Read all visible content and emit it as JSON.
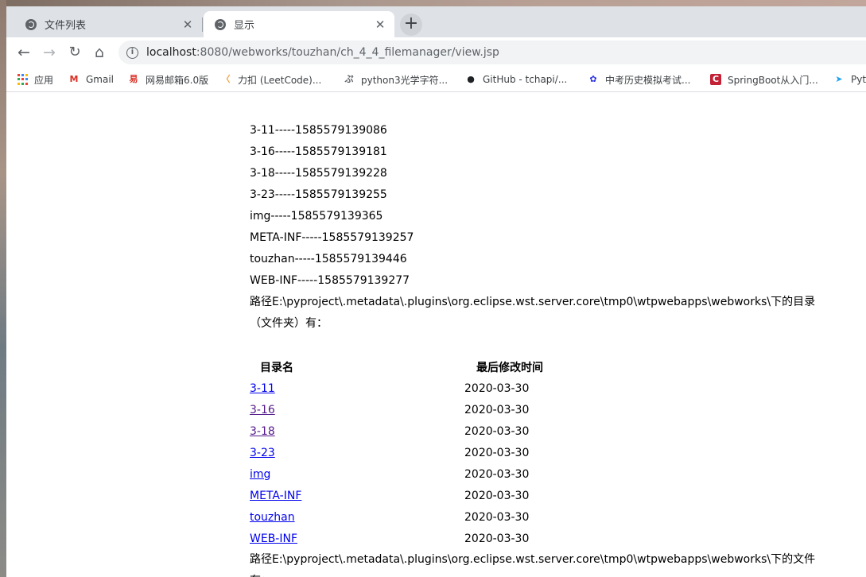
{
  "browser": {
    "tabs": [
      {
        "title": "文件列表",
        "close": "✕",
        "active": false
      },
      {
        "title": "显示",
        "close": "✕",
        "active": true
      }
    ],
    "new_tab": "+",
    "nav": {
      "back": "←",
      "forward": "→",
      "reload": "↻",
      "home": "⌂"
    },
    "url": {
      "host": "localhost",
      "rest": ":8080/webworks/touzhan/ch_4_4_filemanager/view.jsp"
    },
    "bookmarks": [
      {
        "label": "应用",
        "icon": "apps-grid-icon"
      },
      {
        "label": "Gmail",
        "icon": "gmail-icon",
        "color": "#d93025",
        "glyph": "M"
      },
      {
        "label": "网易邮箱6.0版",
        "icon": "netease-mail-icon",
        "color": "#d93025",
        "glyph": "易"
      },
      {
        "label": "力扣 (LeetCode)...",
        "icon": "leetcode-icon",
        "color": "#f0a03c",
        "glyph": "〈"
      },
      {
        "label": "python3光学字符...",
        "icon": "python-ocr-icon",
        "color": "#5f6368",
        "glyph": "ぷ"
      },
      {
        "label": "GitHub - tchapi/...",
        "icon": "github-icon",
        "color": "#202124",
        "glyph": "●"
      },
      {
        "label": "中考历史模拟考试...",
        "icon": "baidu-icon",
        "color": "#2932e1",
        "glyph": "✿"
      },
      {
        "label": "SpringBoot从入门...",
        "icon": "csdn-icon",
        "color": "#c32136",
        "glyph": "C"
      },
      {
        "label": "Pyt",
        "icon": "python-bird-icon",
        "color": "#1da1f2",
        "glyph": "➤"
      }
    ]
  },
  "page": {
    "entries": [
      "3-11-----1585579139086",
      "3-16-----1585579139181",
      "3-18-----1585579139228",
      "3-23-----1585579139255",
      "img-----1585579139365",
      "META-INF-----1585579139257",
      "touzhan-----1585579139446",
      "WEB-INF-----1585579139277"
    ],
    "dirs_heading": "路径E:\\pyproject\\.metadata\\.plugins\\org.eclipse.wst.server.core\\tmp0\\wtpwebapps\\webworks\\下的目录（文件夹）有：",
    "table": {
      "headers": [
        "目录名",
        "最后修改时间"
      ],
      "rows": [
        {
          "name": "3-11",
          "date": "2020-03-30",
          "visited": false
        },
        {
          "name": "3-16",
          "date": "2020-03-30",
          "visited": true
        },
        {
          "name": "3-18",
          "date": "2020-03-30",
          "visited": true
        },
        {
          "name": "3-23",
          "date": "2020-03-30",
          "visited": false
        },
        {
          "name": "img",
          "date": "2020-03-30",
          "visited": false
        },
        {
          "name": "META-INF",
          "date": "2020-03-30",
          "visited": false
        },
        {
          "name": "touzhan",
          "date": "2020-03-30",
          "visited": false
        },
        {
          "name": "WEB-INF",
          "date": "2020-03-30",
          "visited": false
        }
      ]
    },
    "files_heading": "路径E:\\pyproject\\.metadata\\.plugins\\org.eclipse.wst.server.core\\tmp0\\wtpwebapps\\webworks\\下的文件有："
  }
}
